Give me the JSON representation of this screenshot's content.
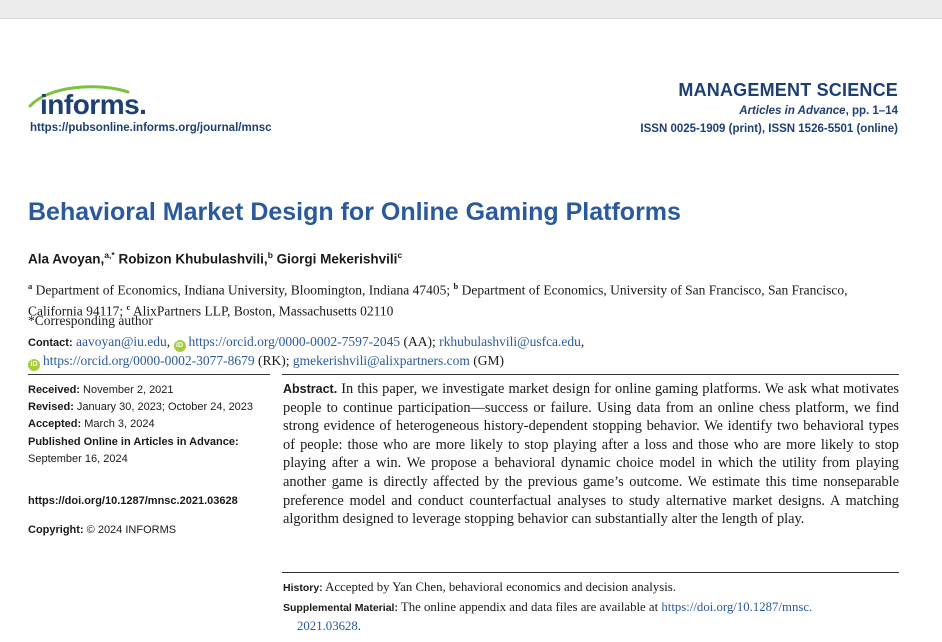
{
  "header": {
    "logo_text": "informs.",
    "journal_url": "https://pubsonline.informs.org/journal/mnsc",
    "journal_name": "MANAGEMENT SCIENCE",
    "article_status_italic": "Articles in Advance",
    "article_status_pages": ", pp. 1–14",
    "issn": "ISSN 0025-1909 (print), ISSN 1526-5501 (online)"
  },
  "paper": {
    "title": "Behavioral Market Design for Online Gaming Platforms",
    "authors": [
      {
        "name": "Ala Avoyan,",
        "sup": "a,*"
      },
      {
        "name": " Robizon Khubulashvili,",
        "sup": "b"
      },
      {
        "name": " Giorgi Mekerishvili",
        "sup": "c"
      }
    ],
    "affiliations": [
      {
        "sup": "a",
        "text": " Department of Economics, Indiana University, Bloomington, Indiana 47405; "
      },
      {
        "sup": "b",
        "text": " Department of Economics, University of San Francisco, San Francisco, California 94117; "
      },
      {
        "sup": "c",
        "text": " AlixPartners LLP, Boston, Massachusetts 02110"
      }
    ],
    "corresponding": "*Corresponding author",
    "contact": {
      "label": "Contact:",
      "email1": "aavoyan@iu.edu",
      "orcid1": "https://orcid.org/0000-0002-7597-2045",
      "orcid1_suffix": " (AA); ",
      "email2": "rkhubulashvili@usfca.edu",
      "orcid2": "https://orcid.org/0000-0002-3077-8679",
      "orcid2_suffix": " (RK); ",
      "email3": "gmekerishvili@alixpartners.com",
      "email3_suffix": " (GM)",
      "orcid_badge": "iD"
    }
  },
  "dates": {
    "received_label": "Received:",
    "received": " November 2, 2021",
    "revised_label": "Revised:",
    "revised": " January 30, 2023; October 24, 2023",
    "accepted_label": "Accepted:",
    "accepted": " March 3, 2024",
    "published_label": "Published Online in Articles in Advance:",
    "published": "September 16, 2024"
  },
  "doi": "https://doi.org/10.1287/mnsc.2021.03628",
  "copyright": {
    "label": "Copyright:",
    "text": " © 2024 INFORMS"
  },
  "abstract": {
    "label": "Abstract.",
    "text": " In this paper, we investigate market design for online gaming platforms. We ask what motivates people to continue participation—success or failure. Using data from an online chess platform, we find strong evidence of heterogeneous history-dependent stop­ping behavior. We identify two behavioral types of people: those who are more likely to stop playing after a loss and those who are more likely to stop playing after a win. We pro­pose a behavioral dynamic choice model in which the utility from playing another game is directly affected by the previous game’s outcome. We estimate this time nonseparable pref­erence model and conduct counterfactual analyses to study alternative market designs. A matching algorithm designed to leverage stopping behavior can substantially alter the length of play."
  },
  "history": {
    "label": "History:",
    "text": " Accepted by Yan Chen, behavioral economics and decision analysis."
  },
  "supplemental": {
    "label": "Supplemental Material:",
    "text": " The online appendix and data files are available at ",
    "link_part1": "https://doi.org/10.1287/mnsc.",
    "link_part2": "2021.03628",
    "end": "."
  },
  "colors": {
    "brand_navy": "#1e3f73",
    "title_blue": "#2a5a9b",
    "logo_green": "#7cc142",
    "orcid_green": "#a6ce39"
  }
}
